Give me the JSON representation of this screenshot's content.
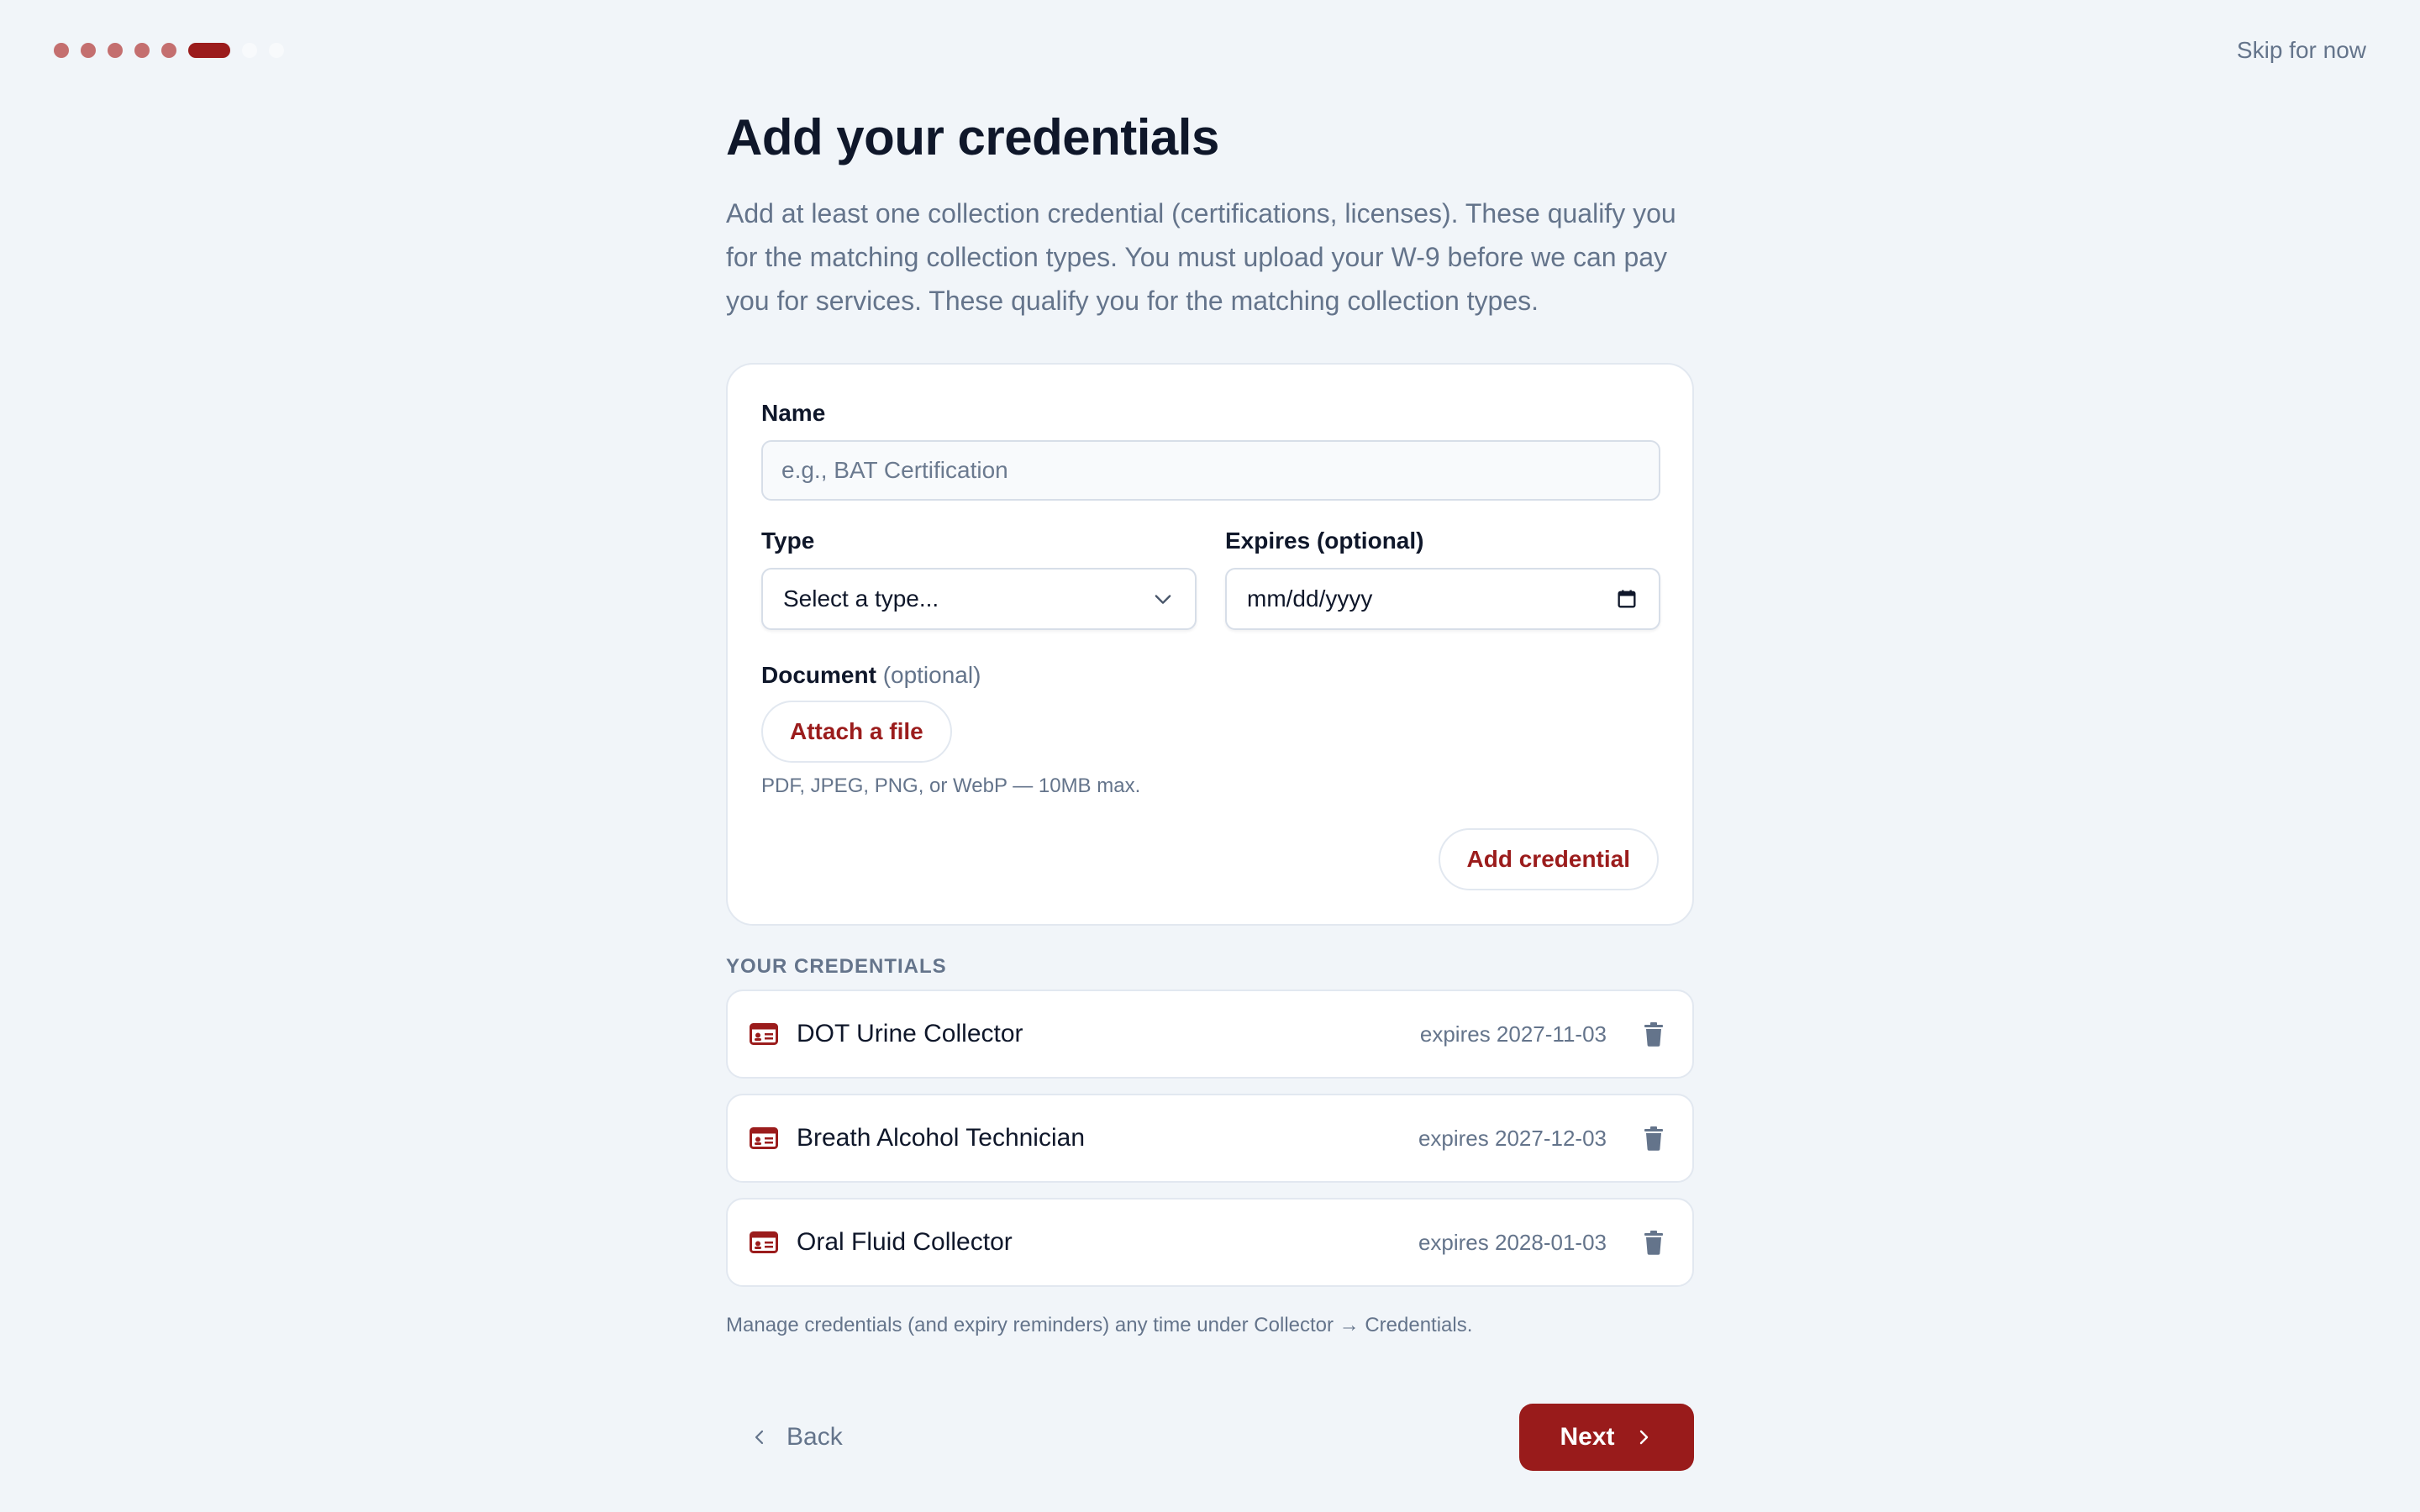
{
  "progress": {
    "total_steps": 9,
    "completed_steps": 5,
    "current_step": 6
  },
  "header": {
    "skip_label": "Skip for now"
  },
  "page": {
    "title": "Add your credentials",
    "description": "Add at least one collection credential (certifications, licenses). These qualify you for the matching collection types. You must upload your W-9 before we can pay you for services. These qualify you for the matching collection types."
  },
  "form": {
    "name_label": "Name",
    "name_placeholder": "e.g., BAT Certification",
    "type_label": "Type",
    "type_selected": "Select a type...",
    "expires_label": "Expires (optional)",
    "expires_placeholder": "mm/dd/yyyy",
    "document_label": "Document",
    "document_optional": "(optional)",
    "attach_label": "Attach a file",
    "file_hint": "PDF, JPEG, PNG, or WebP — 10MB max.",
    "add_label": "Add credential"
  },
  "credentials": {
    "heading": "YOUR CREDENTIALS",
    "items": [
      {
        "name": "DOT Urine Collector",
        "expiry": "expires 2027-11-03"
      },
      {
        "name": "Breath Alcohol Technician",
        "expiry": "expires 2027-12-03"
      },
      {
        "name": "Oral Fluid Collector",
        "expiry": "expires 2028-01-03"
      }
    ],
    "icons": {
      "item": "id-card-icon",
      "delete": "trash-icon"
    }
  },
  "footer": {
    "note": "Manage credentials (and expiry reminders) any time under Collector → Credentials.",
    "back_label": "Back",
    "next_label": "Next"
  },
  "colors": {
    "accent": "#991b1b",
    "accent_light": "#c46f6f",
    "muted_text": "#64748b",
    "background": "#f1f5f9"
  }
}
